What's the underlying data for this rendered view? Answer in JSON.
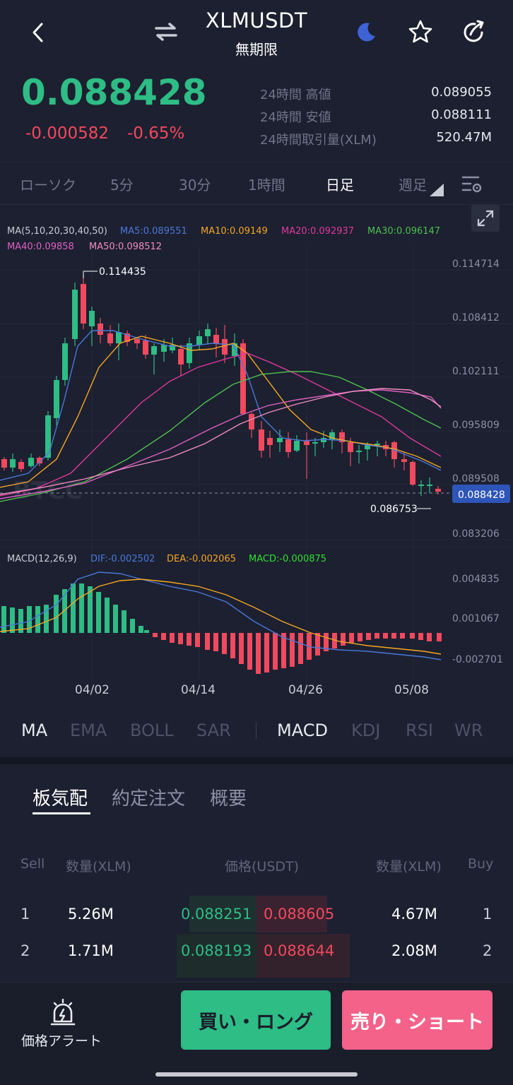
{
  "header": {
    "symbol": "XLMUSDT",
    "contract": "無期限"
  },
  "ticker": {
    "last_price": "0.088428",
    "change_abs": "-0.000582",
    "change_pct": "-0.65%",
    "stats": [
      {
        "label": "24時間 高値",
        "value": "0.089055"
      },
      {
        "label": "24時間 安値",
        "value": "0.088111"
      },
      {
        "label": "24時間取引量(XLM)",
        "value": "520.47M"
      }
    ]
  },
  "timeframes": [
    {
      "label": "ローソク",
      "active": false
    },
    {
      "label": "5分",
      "active": false
    },
    {
      "label": "30分",
      "active": false
    },
    {
      "label": "1時間",
      "active": false
    },
    {
      "label": "日足",
      "active": true
    },
    {
      "label": "週足",
      "active": false
    }
  ],
  "chart_data": {
    "type": "candlestick",
    "ma_legend": {
      "title": "MA(5,10,20,30,40,50)",
      "items": [
        {
          "label": "MA5:0.089551",
          "color": "#4a78d8"
        },
        {
          "label": "MA10:0.09149",
          "color": "#f5a623"
        },
        {
          "label": "MA20:0.092937",
          "color": "#e0389f"
        },
        {
          "label": "MA30:0.096147",
          "color": "#4fbf4f"
        },
        {
          "label": "MA40:0.09858",
          "color": "#e05fc2"
        },
        {
          "label": "MA50:0.098512",
          "color": "#f08cc0"
        }
      ]
    },
    "price_axis": [
      "0.114714",
      "0.108412",
      "0.102111",
      "0.095809",
      "0.089508",
      "0.083206"
    ],
    "current_price_tag": "0.088428",
    "high_marker": "0.114435",
    "low_marker": "0.086753",
    "watermark": "BTCC",
    "macd_legend": {
      "title": "MACD(12,26,9)",
      "items": [
        {
          "label": "DIF:-0.002502",
          "color": "#4a78d8"
        },
        {
          "label": "DEA:-0.002065",
          "color": "#f5a623"
        },
        {
          "label": "MACD:-0.000875",
          "color": "#2ee02e"
        }
      ]
    },
    "macd_axis": [
      "0.004835",
      "0.001067",
      "-0.002701"
    ],
    "x_axis": [
      "04/02",
      "04/14",
      "04/26",
      "05/08"
    ]
  },
  "indicators": {
    "main": [
      {
        "label": "MA",
        "active": true
      },
      {
        "label": "EMA",
        "active": false
      },
      {
        "label": "BOLL",
        "active": false
      },
      {
        "label": "SAR",
        "active": false
      }
    ],
    "sub": [
      {
        "label": "MACD",
        "active": true
      },
      {
        "label": "KDJ",
        "active": false
      },
      {
        "label": "RSI",
        "active": false
      },
      {
        "label": "WR",
        "active": false
      }
    ]
  },
  "orderbook": {
    "tabs": [
      {
        "label": "板気配",
        "active": true
      },
      {
        "label": "約定注文",
        "active": false
      },
      {
        "label": "概要",
        "active": false
      }
    ],
    "headers": {
      "sell": "Sell",
      "qty_left": "数量(XLM)",
      "price": "価格(USDT)",
      "qty_right": "数量(XLM)",
      "buy": "Buy"
    },
    "rows": [
      {
        "idx_left": "1",
        "qty_left": "5.26M",
        "bid": "0.088251",
        "ask": "0.088605",
        "qty_right": "4.67M",
        "idx_right": "1"
      },
      {
        "idx_left": "2",
        "qty_left": "1.71M",
        "bid": "0.088193",
        "ask": "0.088644",
        "qty_right": "2.08M",
        "idx_right": "2"
      }
    ]
  },
  "bottom": {
    "alert_label": "価格アラート",
    "buy_label": "買い・ロング",
    "sell_label": "売り・ショート"
  }
}
